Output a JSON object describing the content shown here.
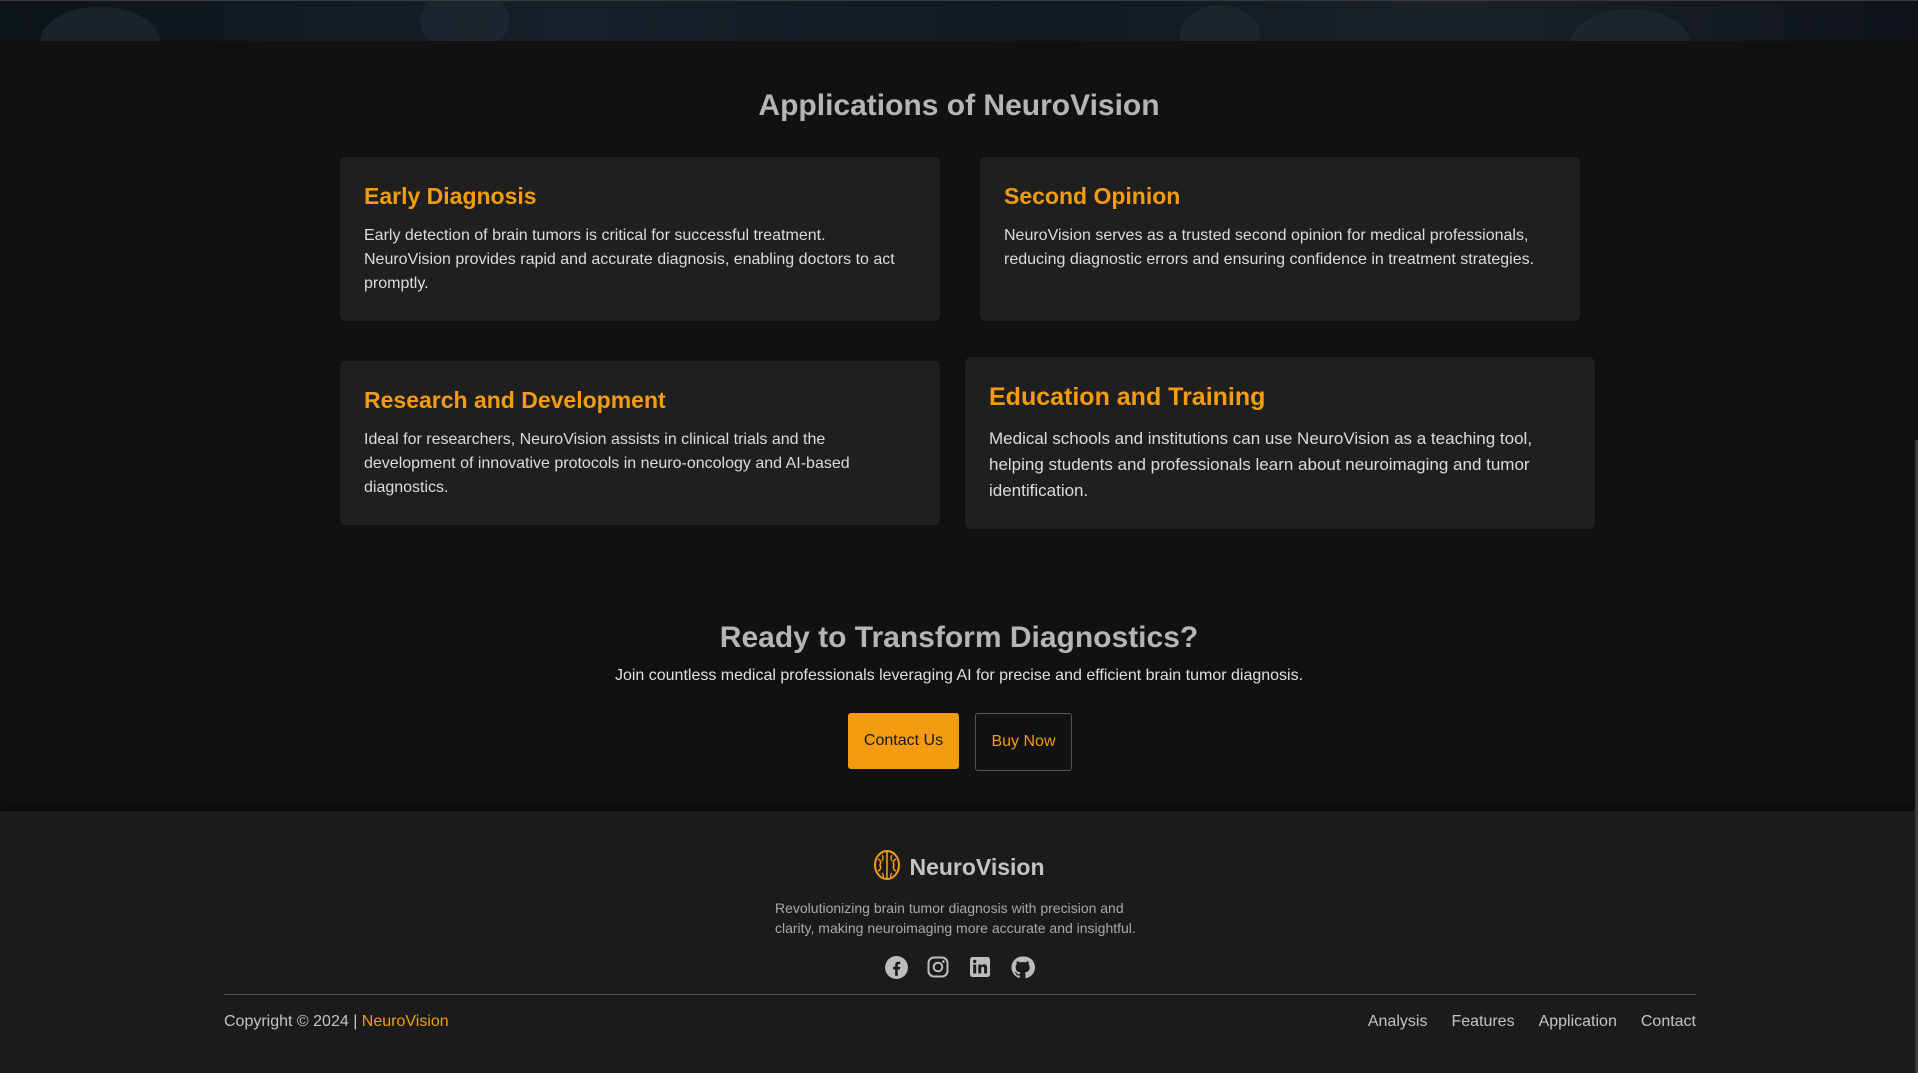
{
  "applications": {
    "title": "Applications of NeuroVision",
    "cards": [
      {
        "title": "Early Diagnosis",
        "text": "Early detection of brain tumors is critical for successful treatment. NeuroVision provides rapid and accurate diagnosis, enabling doctors to act promptly."
      },
      {
        "title": "Second Opinion",
        "text": "NeuroVision serves as a trusted second opinion for medical professionals, reducing diagnostic errors and ensuring confidence in treatment strategies."
      },
      {
        "title": "Research and Development",
        "text": "Ideal for researchers, NeuroVision assists in clinical trials and the development of innovative protocols in neuro-oncology and AI-based diagnostics."
      },
      {
        "title": "Education and Training",
        "text": "Medical schools and institutions can use NeuroVision as a teaching tool, helping students and professionals learn about neuroimaging and tumor identification."
      }
    ]
  },
  "cta": {
    "title": "Ready to Transform Diagnostics?",
    "subtitle": "Join countless medical professionals leveraging AI for precise and efficient brain tumor diagnosis.",
    "contact_label": "Contact Us",
    "buy_label": "Buy Now"
  },
  "footer": {
    "brand": "NeuroVision",
    "tagline": "Revolutionizing brain tumor diagnosis with precision and clarity, making neuroimaging more accurate and insightful.",
    "socials": [
      "facebook-icon",
      "instagram-icon",
      "linkedin-icon",
      "github-icon"
    ],
    "copyright_prefix": "Copyright © 2024 | ",
    "copyright_brand": "NeuroVision",
    "nav": [
      "Analysis",
      "Features",
      "Application",
      "Contact"
    ]
  },
  "colors": {
    "accent": "#f39c12",
    "background": "#111111",
    "card": "#1f1f1f",
    "footer": "#1b1b1b"
  }
}
